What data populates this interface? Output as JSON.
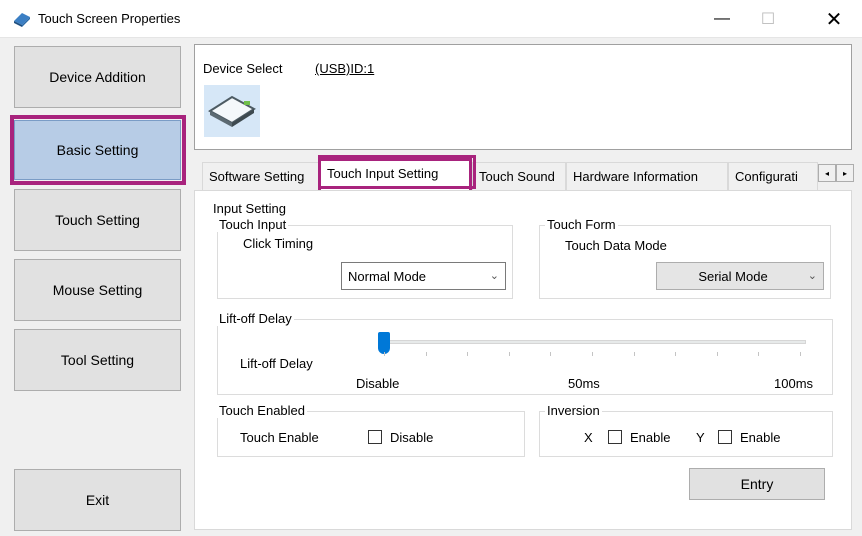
{
  "window": {
    "title": "Touch Screen Properties",
    "controls": {
      "minimize": "—",
      "maximize": "☐",
      "close": "✕"
    }
  },
  "sidebar": {
    "items": [
      {
        "label": "Device Addition",
        "active": false
      },
      {
        "label": "Basic Setting",
        "active": true
      },
      {
        "label": "Touch Setting",
        "active": false
      },
      {
        "label": "Mouse Setting",
        "active": false
      },
      {
        "label": "Tool Setting",
        "active": false
      }
    ],
    "exit_label": "Exit"
  },
  "device": {
    "select_label": "Device Select",
    "id_label": "(USB)ID:1",
    "icon": "touch-screen-device-icon"
  },
  "tabs": {
    "items": [
      {
        "label": "Software Setting",
        "selected": false
      },
      {
        "label": "Touch Input Setting",
        "selected": true
      },
      {
        "label": "Touch Sound",
        "selected": false
      },
      {
        "label": "Hardware Information",
        "selected": false
      },
      {
        "label": "Configurati",
        "selected": false
      }
    ],
    "arrow_left": "◂",
    "arrow_right": "▸"
  },
  "input_setting": {
    "title": "Input Setting",
    "touch_input": {
      "title": "Touch Input",
      "click_timing_label": "Click Timing",
      "click_timing_value": "Normal Mode"
    },
    "touch_form": {
      "title": "Touch Form",
      "data_mode_label": "Touch Data Mode",
      "data_mode_value": "Serial Mode"
    }
  },
  "lift_off": {
    "title": "Lift-off Delay",
    "label": "Lift-off Delay",
    "tick_labels": [
      "Disable",
      "50ms",
      "100ms"
    ],
    "value_fraction": 0
  },
  "touch_enabled": {
    "title": "Touch Enabled",
    "label": "Touch Enable",
    "checkbox_label": "Disable",
    "checked": false
  },
  "inversion": {
    "title": "Inversion",
    "x_label": "X",
    "x_checkbox_label": "Enable",
    "y_label": "Y",
    "y_checkbox_label": "Enable"
  },
  "entry_label": "Entry",
  "colors": {
    "highlight": "#a8237d",
    "active_sidebar": "#b7cce6",
    "slider_thumb": "#0078d7"
  }
}
